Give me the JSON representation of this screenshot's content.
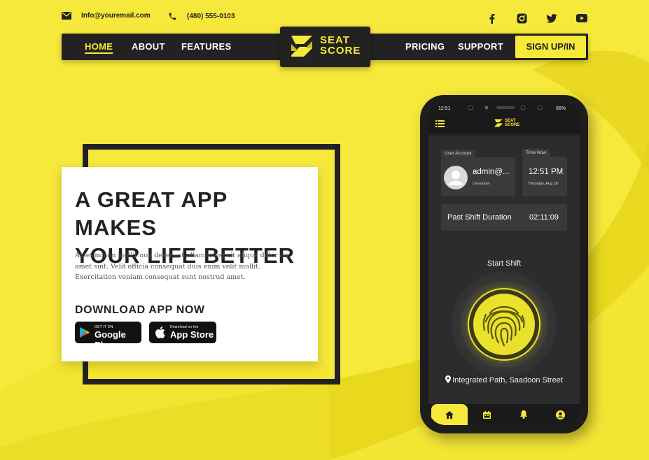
{
  "contact": {
    "email": "Info@youremail.com",
    "phone": "(480) 555-0103"
  },
  "social": [
    "facebook-icon",
    "instagram-icon",
    "twitter-icon",
    "youtube-icon"
  ],
  "nav": {
    "home": "HOME",
    "about": "ABOUT",
    "features": "FEATURES",
    "pricing": "PRICING",
    "support": "SUPPORT",
    "signup": "SIGN UP/IN"
  },
  "logo": {
    "line1": "SEAT",
    "line2": "SCORE"
  },
  "hero": {
    "headline_1": "A GREAT APP MAKES",
    "headline_2": "YOUR LIFE BETTER",
    "paragraph": "Amet minim mollit non deserunt ullamco est sit aliqua dolor do amet sint. Velit officia consequat duis enim velit mollit. Exercitation veniam consequat sunt nostrud amet.",
    "download_title": "DOWNLOAD APP NOW",
    "google_small": "GET IT ON",
    "google_big": "Google Play",
    "apple_small": "Download on the",
    "apple_big": "App Store"
  },
  "phone": {
    "status_time": "12:51",
    "status_battery": "56%",
    "app_logo_1": "SEAT",
    "app_logo_2": "SCORE",
    "user_account_tag": "User Account",
    "user_name": "admin@...",
    "user_role": "Developer",
    "time_now_tag": "Time Now",
    "time_now": "12:51 PM",
    "date_now": "Thursday, Aug 18",
    "past_shift_label": "Past Shift Duration",
    "past_shift_value": "02:11:09",
    "start_shift": "Start Shift",
    "location": "Integrated Path, Saadoon Street"
  },
  "colors": {
    "accent": "#f7e93b",
    "dark": "#222222",
    "screen": "#2c2c2c",
    "fingerprint": "#e9e12c"
  }
}
